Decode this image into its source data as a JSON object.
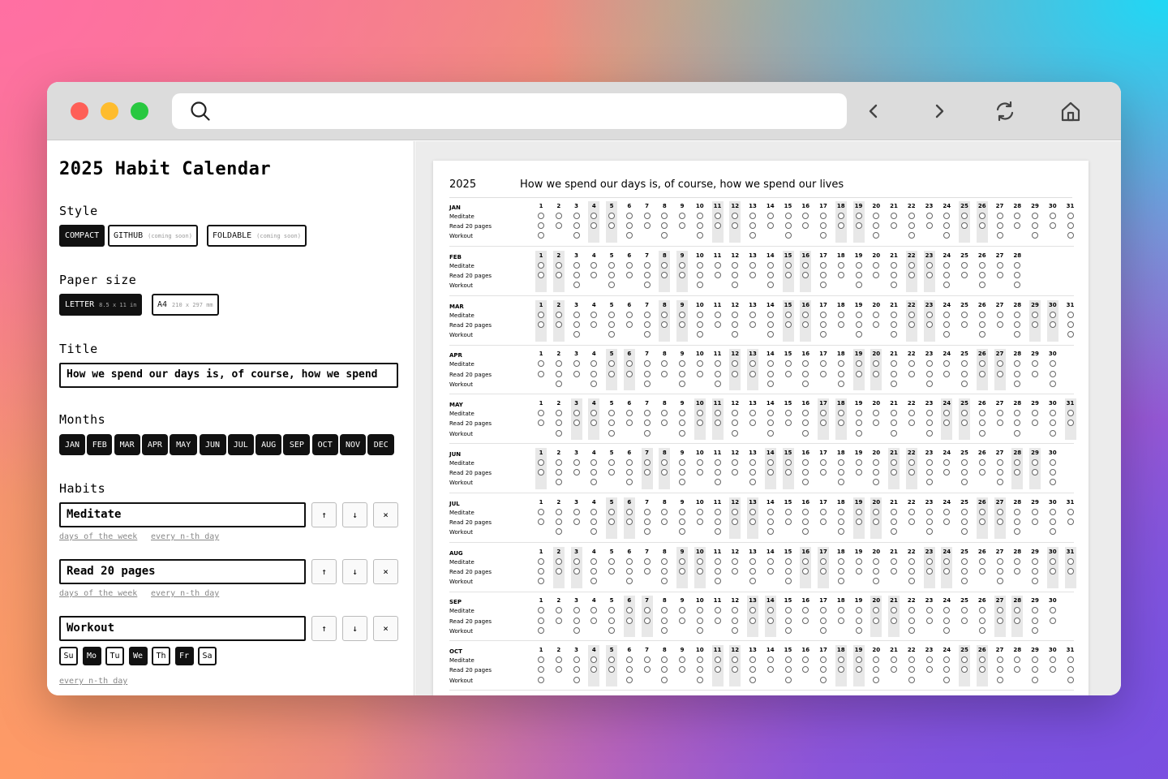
{
  "app": {
    "title": "2025 Habit Calendar"
  },
  "style": {
    "heading": "Style",
    "options": [
      {
        "label": "COMPACT",
        "sub": "",
        "selected": true
      },
      {
        "label": "GITHUB",
        "sub": "(coming soon)",
        "selected": false
      },
      {
        "label": "FOLDABLE",
        "sub": "(coming soon)",
        "selected": false
      }
    ]
  },
  "paper_size": {
    "heading": "Paper size",
    "options": [
      {
        "label": "LETTER",
        "sub": "8.5 x 11 in",
        "selected": true
      },
      {
        "label": "A4",
        "sub": "210 x 297 mm",
        "selected": false
      }
    ]
  },
  "title_field": {
    "heading": "Title",
    "value": "How we spend our days is, of course, how we spend"
  },
  "months_section": {
    "heading": "Months",
    "items": [
      "JAN",
      "FEB",
      "MAR",
      "APR",
      "MAY",
      "JUN",
      "JUL",
      "AUG",
      "SEP",
      "OCT",
      "NOV",
      "DEC"
    ]
  },
  "habits_section": {
    "heading": "Habits",
    "up_glyph": "↑",
    "down_glyph": "↓",
    "remove_glyph": "×",
    "days_link": "days of the week",
    "nth_link": "every n-th day",
    "habits": [
      {
        "name": "Meditate"
      },
      {
        "name": "Read 20 pages"
      },
      {
        "name": "Workout"
      }
    ],
    "weekdays": [
      {
        "label": "Su",
        "selected": false
      },
      {
        "label": "Mo",
        "selected": true
      },
      {
        "label": "Tu",
        "selected": false
      },
      {
        "label": "We",
        "selected": true
      },
      {
        "label": "Th",
        "selected": false
      },
      {
        "label": "Fr",
        "selected": true
      },
      {
        "label": "Sa",
        "selected": false
      }
    ]
  },
  "preview": {
    "year": "2025",
    "quote": "How we spend our days is, of course, how we spend our lives",
    "habit_rows": [
      "Meditate",
      "Read 20 pages",
      "Workout"
    ],
    "months": [
      {
        "label": "JAN",
        "days": 31,
        "first_weekday": 3
      },
      {
        "label": "FEB",
        "days": 28,
        "first_weekday": 6
      },
      {
        "label": "MAR",
        "days": 31,
        "first_weekday": 6
      },
      {
        "label": "APR",
        "days": 30,
        "first_weekday": 2
      },
      {
        "label": "MAY",
        "days": 31,
        "first_weekday": 4
      },
      {
        "label": "JUN",
        "days": 30,
        "first_weekday": 0
      },
      {
        "label": "JUL",
        "days": 31,
        "first_weekday": 2
      },
      {
        "label": "AUG",
        "days": 31,
        "first_weekday": 5
      },
      {
        "label": "SEP",
        "days": 30,
        "first_weekday": 1
      },
      {
        "label": "OCT",
        "days": 31,
        "first_weekday": 3
      }
    ]
  },
  "colors": {
    "ink": "#111111",
    "weekend_highlight": "#e8e8e8",
    "traffic_red": "#fe5f57",
    "traffic_yellow": "#febc2e",
    "traffic_green": "#28c840"
  }
}
